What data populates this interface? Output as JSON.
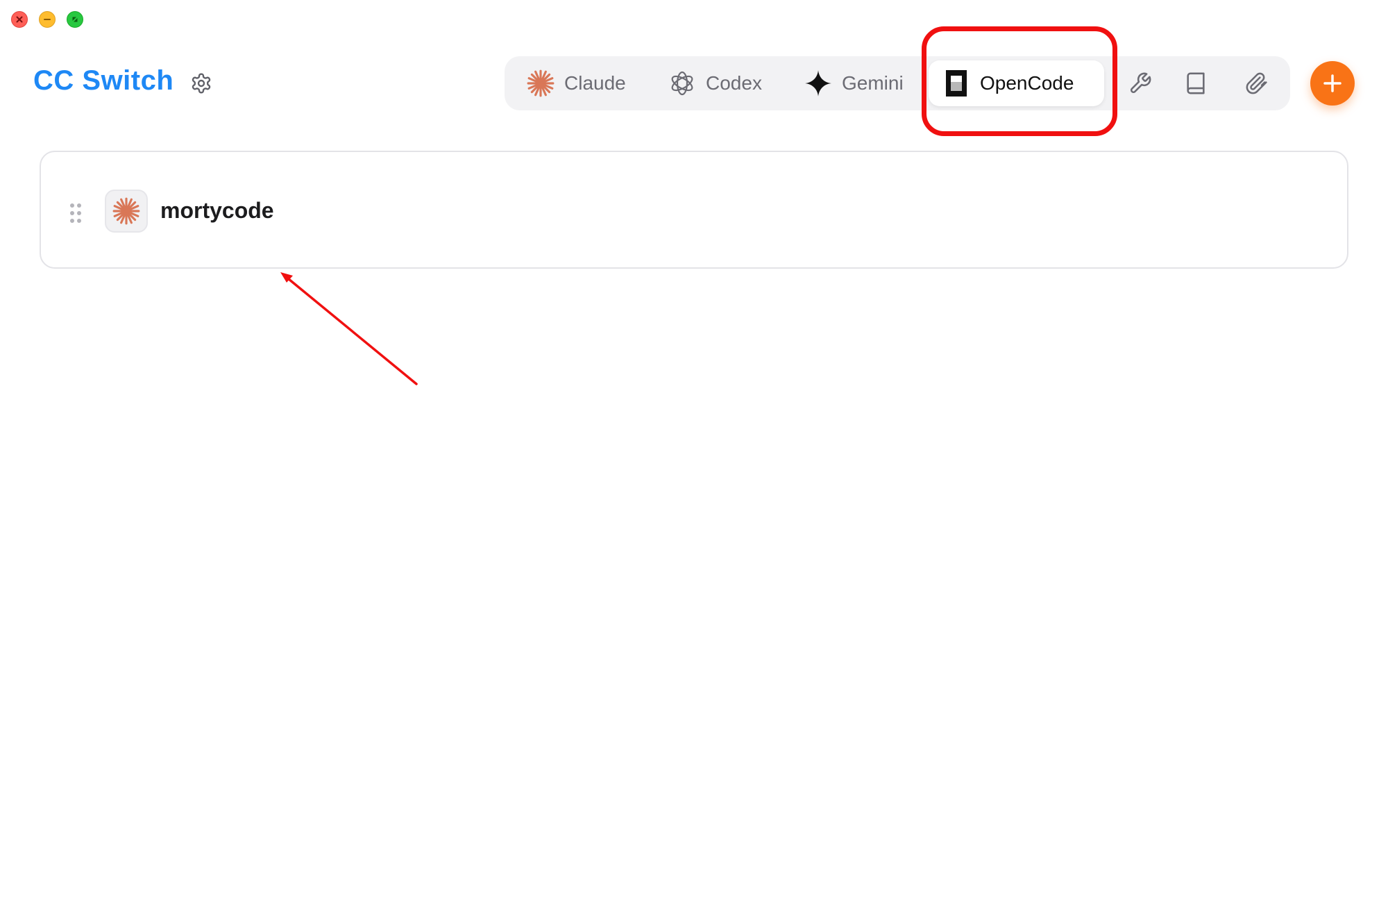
{
  "window": {
    "controls": [
      "close",
      "minimize",
      "zoom"
    ]
  },
  "header": {
    "title": "CC Switch",
    "settings_icon": "gear-icon"
  },
  "tabs": [
    {
      "label": "Claude",
      "icon": "claude-asterisk-icon",
      "active": false
    },
    {
      "label": "Codex",
      "icon": "openai-knot-icon",
      "active": false
    },
    {
      "label": "Gemini",
      "icon": "gemini-sparkle-icon",
      "active": false
    },
    {
      "label": "OpenCode",
      "icon": "opencode-square-icon",
      "active": true
    }
  ],
  "tools": [
    {
      "icon": "wrench-icon"
    },
    {
      "icon": "book-icon"
    },
    {
      "icon": "paperclip-icon"
    }
  ],
  "add_button": {
    "icon": "plus-icon"
  },
  "providers": [
    {
      "name": "mortycode",
      "icon": "claude-asterisk-icon"
    }
  ],
  "colors": {
    "brand_blue": "#1e88f5",
    "accent_orange": "#f97316",
    "claude_orange": "#d97757",
    "annotation_red": "#f01010"
  }
}
